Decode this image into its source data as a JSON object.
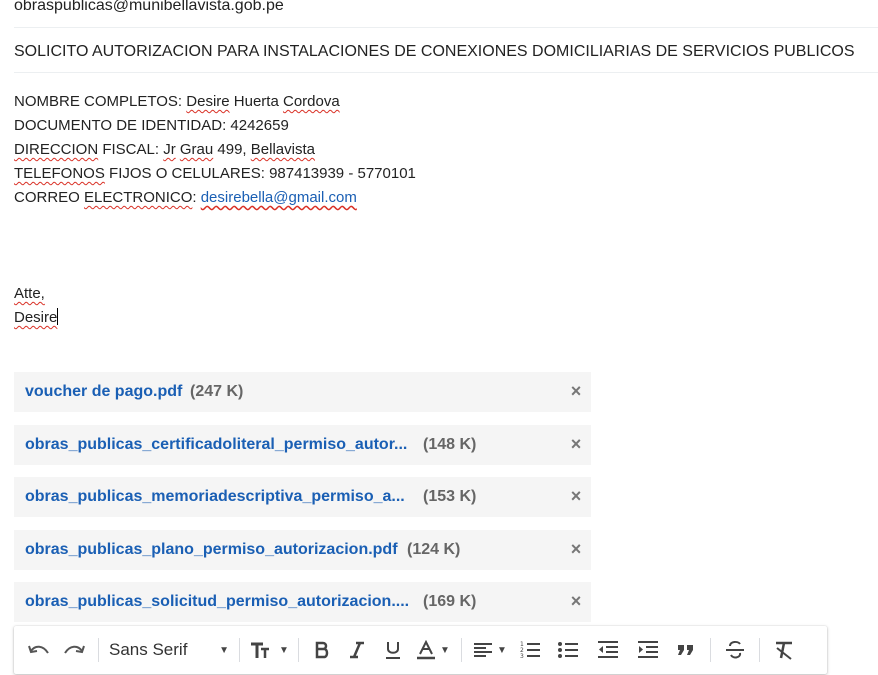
{
  "recipient": "obraspublicas@munibellavista.gob.pe",
  "subject": "SOLICITO AUTORIZACION PARA INSTALACIONES DE CONEXIONES DOMICILIARIAS DE SERVICIOS PUBLICOS",
  "body": {
    "line1_prefix": "NOMBRE COMPLETOS: ",
    "line1_first": "Desire",
    "line1_mid": " Huerta ",
    "line1_last": "Cordova",
    "line2": "DOCUMENTO DE IDENTIDAD: 4242659",
    "line3_word1": "DIRECCION",
    "line3_mid": " FISCAL: ",
    "line3_jr": "Jr",
    "line3_space": " ",
    "line3_grau": "Grau",
    "line3_num": " 499, ",
    "line3_city": "Bellavista",
    "line4_word": "TELEFONOS",
    "line4_rest": " FIJOS O CELULARES: 987413939 - 5770101",
    "line5_prefix": "CORREO ",
    "line5_word": "ELECTRONICO",
    "line5_colon": ": ",
    "line5_email": "desirebella@gmail.com",
    "closing": "Atte,",
    "signature": "Desire"
  },
  "attachments": [
    {
      "name": "voucher de pago.pdf",
      "size": "(247 K)"
    },
    {
      "name": "obras_publicas_certificadoliteral_permiso_autor...",
      "size": "(148 K)"
    },
    {
      "name": "obras_publicas_memoriadescriptiva_permiso_a...",
      "size": "(153 K)"
    },
    {
      "name": "obras_publicas_plano_permiso_autorizacion.pdf",
      "size": "(124 K)"
    },
    {
      "name": "obras_publicas_solicitud_permiso_autorizacion....",
      "size": "(169 K)"
    }
  ],
  "attachment_close_glyph": "×",
  "toolbar": {
    "font_family": "Sans Serif",
    "icons": [
      "undo-icon",
      "redo-icon",
      "font-size-icon",
      "bold-icon",
      "italic-icon",
      "underline-icon",
      "text-color-icon",
      "align-icon",
      "numbered-list-icon",
      "bulleted-list-icon",
      "indent-less-icon",
      "indent-more-icon",
      "quote-icon",
      "strikethrough-icon",
      "remove-formatting-icon"
    ]
  },
  "colors": {
    "link": "#1a5fb4",
    "attachment_bg": "#f5f5f5",
    "spellcheck": "#d93025"
  }
}
